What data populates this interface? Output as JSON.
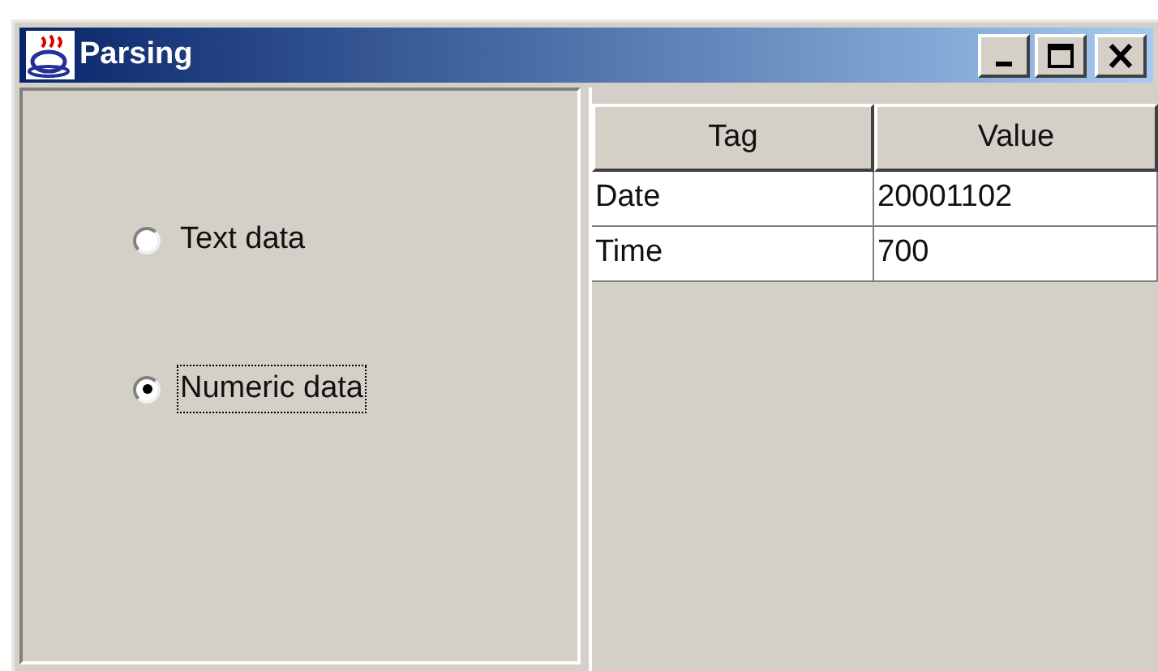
{
  "window": {
    "title": "Parsing"
  },
  "options": [
    {
      "label": "Text data",
      "selected": false,
      "focused": false
    },
    {
      "label": "Numeric data",
      "selected": true,
      "focused": true
    }
  ],
  "table": {
    "columns": [
      "Tag",
      "Value"
    ],
    "rows": [
      [
        "Date",
        "20001102"
      ],
      [
        "Time",
        "700"
      ]
    ]
  }
}
